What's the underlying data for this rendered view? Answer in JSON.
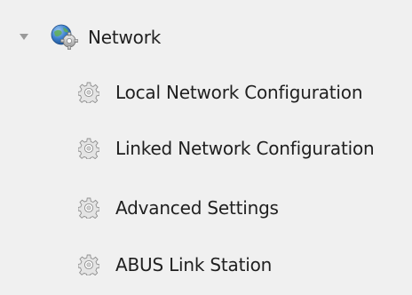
{
  "tree": {
    "root": {
      "label": "Network",
      "icon": "network-gear-icon",
      "expander_icon": "expanded-triangle-icon",
      "expanded": true
    },
    "children": [
      {
        "label": "Local Network Configuration",
        "icon": "settings-gear-icon"
      },
      {
        "label": "Linked Network Configuration",
        "icon": "settings-gear-icon"
      },
      {
        "label": "Advanced Settings",
        "icon": "settings-gear-icon"
      },
      {
        "label": "ABUS Link Station",
        "icon": "settings-gear-icon"
      }
    ]
  },
  "colors": {
    "panel_background": "#f0f0f0",
    "text": "#1f1f1f",
    "globe_blue": "#2f6fb8",
    "gear_gray": "#a8a8a8"
  }
}
